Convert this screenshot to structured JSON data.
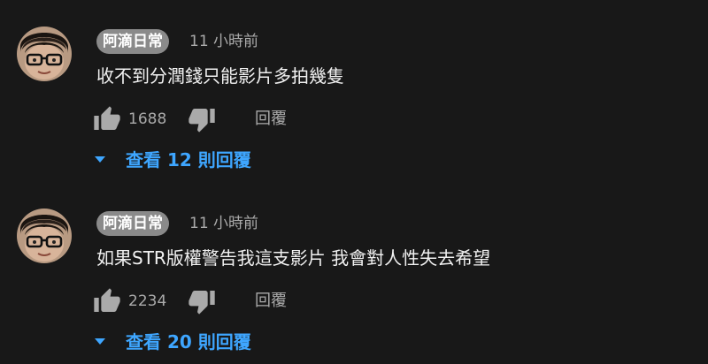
{
  "comments": [
    {
      "author": "阿滴日常",
      "timestamp": "11 小時前",
      "text": "收不到分潤錢只能影片多拍幾隻",
      "like_count": "1688",
      "reply_label": "回覆",
      "view_replies": "查看 12 則回覆"
    },
    {
      "author": "阿滴日常",
      "timestamp": "11 小時前",
      "text": "如果STR版權警告我這支影片 我會對人性失去希望",
      "like_count": "2234",
      "reply_label": "回覆",
      "view_replies": "查看 20 則回覆"
    }
  ],
  "colors": {
    "background": "#181818",
    "badge": "#8a8a8a",
    "link": "#3ea6ff",
    "secondary_text": "#aaaaaa"
  },
  "icons": {
    "like": "thumb-up-icon",
    "dislike": "thumb-down-icon",
    "expand": "caret-down-icon"
  }
}
